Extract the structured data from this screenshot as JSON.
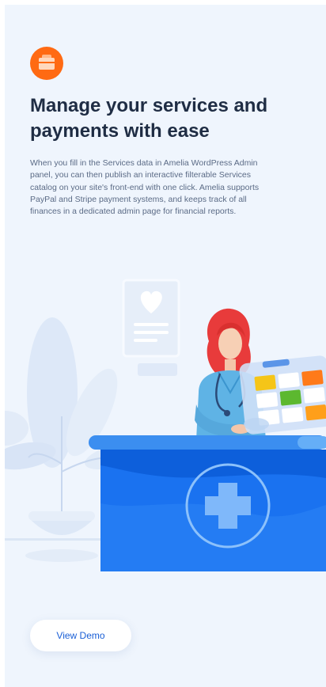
{
  "feature": {
    "icon": "services-icon",
    "accent_color": "#ff6a13"
  },
  "hero": {
    "title": "Manage your services and payments with ease",
    "description": "When you fill in the Services data in Amelia WordPress Admin panel, you can then publish an interactive filterable Services catalog on your site's front-end with one click. Amelia supports PayPal and Stripe payment systems, and keeps track of all finances in a dedicated admin page for financial reports."
  },
  "illustration": {
    "subject": "nurse-at-reception-desk",
    "desk_icon": "medical-cross-icon",
    "panel_tile_colors": [
      "#f5c518",
      "#ffffff",
      "#ff7a1a",
      "#ffffff",
      "#5cb82f",
      "#ffffff",
      "#ffffff",
      "#ffffff",
      "#ff9f1a"
    ]
  },
  "cta": {
    "label": "View Demo",
    "color": "#1a5fd6"
  }
}
